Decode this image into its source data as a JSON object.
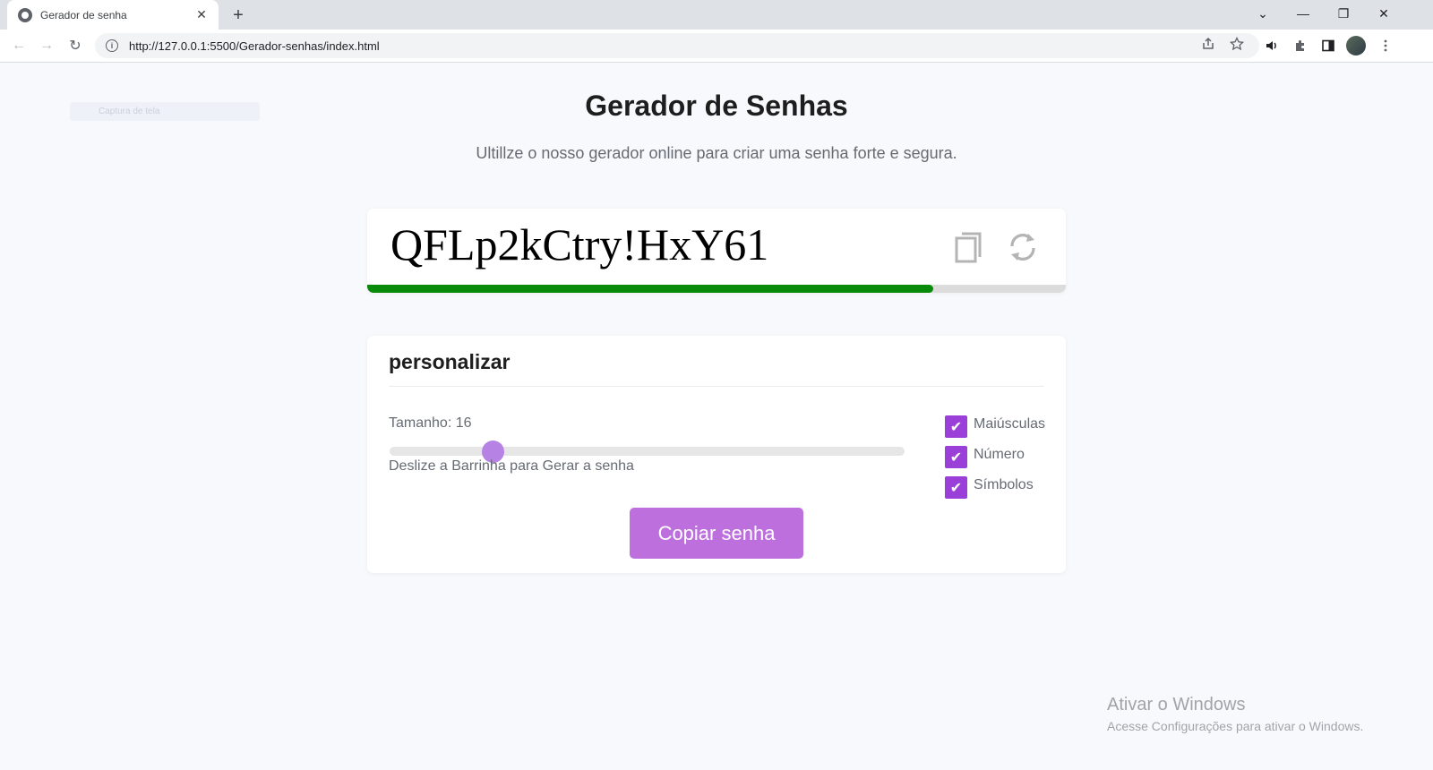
{
  "browser": {
    "tab_title": "Gerador de senha",
    "tab_close": "✕",
    "new_tab": "+",
    "url": "http://127.0.0.1:5500/Gerador-senhas/index.html",
    "window_controls": {
      "list": "⌄",
      "minimize": "—",
      "restore": "❐",
      "close": "✕"
    },
    "nav": {
      "back": "←",
      "forward": "→",
      "reload": "↻"
    }
  },
  "page": {
    "ghost_badge": "Captura de tela",
    "title": "Gerador de Senhas",
    "subtitle": "Ultillze o nosso gerador online para criar uma senha forte e segura.",
    "password": "QFLp2kCtry!HxY61",
    "strength": {
      "fraction": 0.81,
      "color": "#0a8a0a"
    },
    "customize": {
      "title": "personalizar",
      "size_label": "Tamanho: 16",
      "length": {
        "value": 16,
        "min": 4,
        "max": 64
      },
      "slider_hint": "Deslize a Barrinha para Gerar a senha",
      "options": [
        {
          "label": "Maiúsculas",
          "checked": true,
          "mark": "✔"
        },
        {
          "label": "Número",
          "checked": true,
          "mark": "✔"
        },
        {
          "label": "Símbolos",
          "checked": true,
          "mark": "✔"
        }
      ],
      "copy_button": "Copiar senha"
    },
    "accent_color": "#bd6fdd",
    "checkbox_color": "#9b3fd9"
  },
  "watermark": {
    "title": "Ativar o Windows",
    "subtitle": "Acesse Configurações para ativar o Windows."
  }
}
